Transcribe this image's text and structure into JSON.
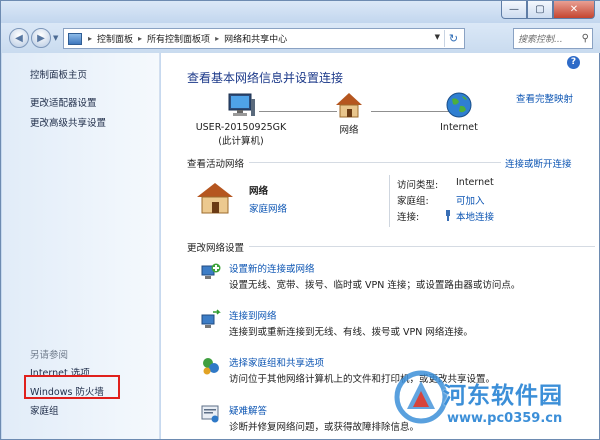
{
  "window": {
    "minimize_icon": "minimize-icon",
    "maximize_icon": "maximize-icon",
    "close_icon": "close-icon",
    "min_glyph": "—",
    "max_glyph": "▢",
    "close_glyph": "✕"
  },
  "address_bar": {
    "back_glyph": "◀",
    "forward_glyph": "▶",
    "breadcrumbs": [
      "控制面板",
      "所有控制面板项",
      "网络和共享中心"
    ],
    "separator": "▸",
    "refresh_glyph": "↻",
    "search_placeholder": "搜索控制...",
    "search_glyph": "⚲"
  },
  "sidebar": {
    "home": "控制面板主页",
    "change_adapter": "更改适配器设置",
    "change_sharing": "更改高级共享设置",
    "see_also": "另请参阅",
    "internet_options": "Internet 选项",
    "firewall": "Windows 防火墙",
    "homegroup": "家庭组"
  },
  "main": {
    "help": "?",
    "title": "查看基本网络信息并设置连接",
    "full_map": "查看完整映射",
    "nodes": [
      {
        "label": "USER-20150925GK",
        "sublabel": "(此计算机)",
        "icon": "computer-icon"
      },
      {
        "label": "网络",
        "icon": "house-icon"
      },
      {
        "label": "Internet",
        "icon": "globe-icon"
      }
    ],
    "active_networks_label": "查看活动网络",
    "connect_disconnect": "连接或断开连接",
    "network": {
      "name": "网络",
      "type": "家庭网络",
      "access_type_label": "访问类型:",
      "access_type_value": "Internet",
      "homegroup_label": "家庭组:",
      "homegroup_value": "可加入",
      "connections_label": "连接:",
      "connections_value": "本地连接"
    },
    "change_settings_label": "更改网络设置",
    "tasks": [
      {
        "link": "设置新的连接或网络",
        "desc": "设置无线、宽带、拨号、临时或 VPN 连接；或设置路由器或访问点。",
        "icon": "new-connection-icon"
      },
      {
        "link": "连接到网络",
        "desc": "连接到或重新连接到无线、有线、拨号或 VPN 网络连接。",
        "icon": "connect-network-icon"
      },
      {
        "link": "选择家庭组和共享选项",
        "desc": "访问位于其他网络计算机上的文件和打印机，或更改共享设置。",
        "icon": "homegroup-icon"
      },
      {
        "link": "疑难解答",
        "desc": "诊断并修复网络问题，或获得故障排除信息。",
        "icon": "troubleshoot-icon"
      }
    ]
  },
  "watermark": {
    "text": "河东软件园",
    "url": "www.pc0359.cn"
  }
}
